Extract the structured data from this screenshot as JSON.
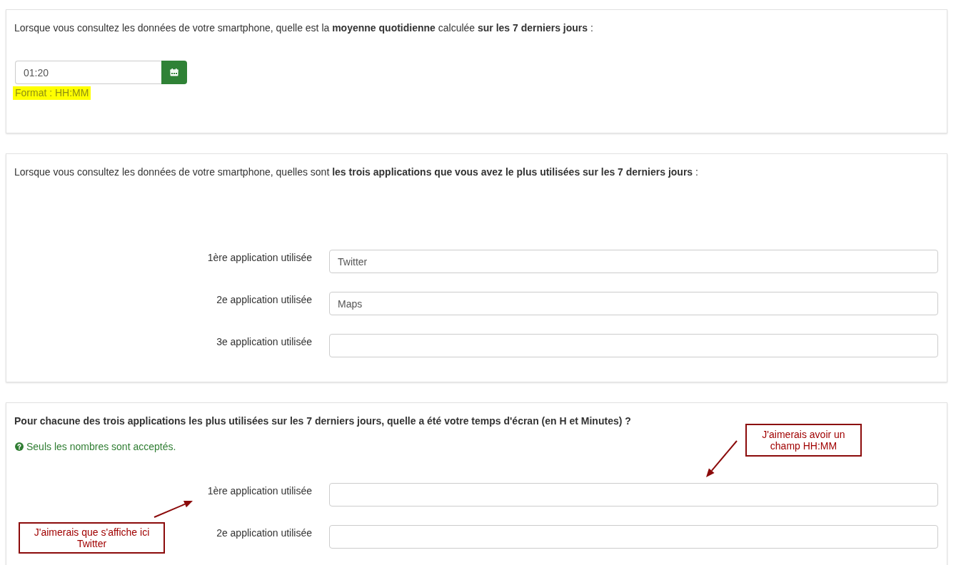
{
  "questions": [
    {
      "kind": "time",
      "prompt": "Lorsque vous consultez les données de votre smartphone, quelle est la **moyenne quotidienne** calculée **sur les 7 derniers jours** :",
      "field": {
        "value": "01:20"
      },
      "hint": "Format : HH:MM"
    },
    {
      "kind": "text_list",
      "prompt": "Lorsque vous consultez les données de votre smartphone, quelles sont **les trois applications que vous avez le plus utilisées sur les 7 derniers jours** :",
      "rows": [
        {
          "label": "1ère application utilisée",
          "value": "Twitter"
        },
        {
          "label": "2e application utilisée",
          "value": "Maps"
        },
        {
          "label": "3e application utilisée"
        }
      ]
    },
    {
      "kind": "number_list",
      "prompt": "Pour chacune des trois applications les plus utilisées sur les 7 derniers jours, quelle a été votre temps d'écran (en H et Minutes) ?",
      "help": "Seuls les nombres sont acceptés.",
      "rows": [
        {
          "label": "1ère application utilisée"
        },
        {
          "label": "2e application utilisée"
        }
      ]
    }
  ],
  "annotations": [
    {
      "text": "J'aimerais avoir un champ HH:MM"
    },
    {
      "text": "J'aimerais que s'affiche ici Twitter"
    }
  ]
}
